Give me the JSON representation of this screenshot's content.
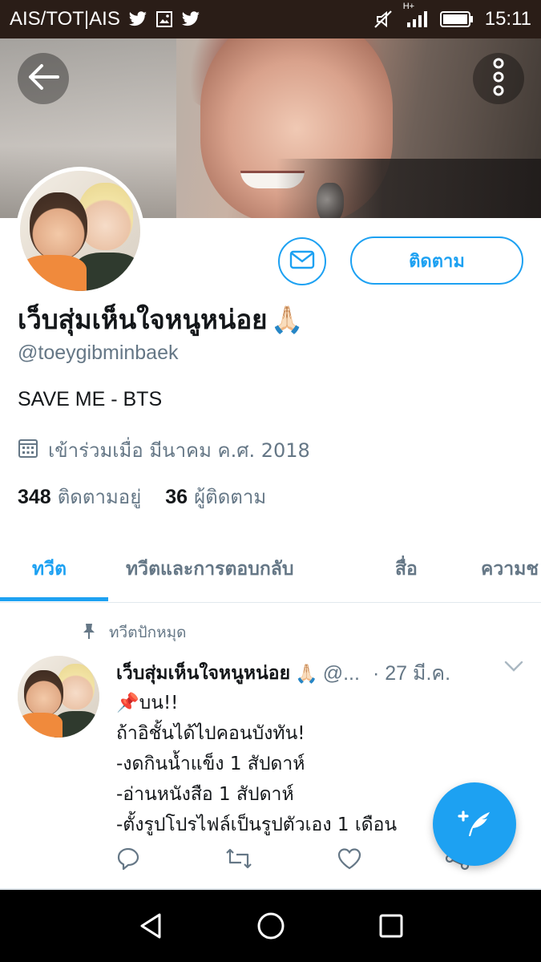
{
  "status_bar": {
    "carrier": "AIS/TOT|AIS",
    "network": "H+",
    "time": "15:11",
    "icons": [
      "twitter-icon",
      "image-notification-icon",
      "twitter-icon",
      "mute-icon",
      "signal-icon",
      "battery-icon"
    ]
  },
  "header": {
    "back_icon": "arrow-left-icon",
    "menu_icon": "more-vertical-icon"
  },
  "profile": {
    "display_name": "เว็บสุ่มเห็นใจหนูหน่อย",
    "name_emoji": "🙏🏻",
    "handle": "@toeygibminbaek",
    "bio": "SAVE ME - BTS",
    "joined": "เข้าร่วมเมื่อ มีนาคม ค.ศ. 2018",
    "following_count": "348",
    "following_label": "ติดตามอยู่",
    "followers_count": "36",
    "followers_label": "ผู้ติดตาม",
    "message_icon": "envelope-icon",
    "follow_label": "ติดตาม"
  },
  "tabs": [
    {
      "label": "ทวีต",
      "active": true
    },
    {
      "label": "ทวีตและการตอบกลับ",
      "active": false
    },
    {
      "label": "สื่อ",
      "active": false
    },
    {
      "label": "ความช",
      "active": false
    }
  ],
  "pinned_tweet": {
    "pinned_label": "ทวีตปักหมุด",
    "author_name": "เว็บสุ่มเห็นใจหนูหน่อย",
    "author_emoji": "🙏🏻",
    "author_handle": "@...",
    "date": "· 27 มี.ค.",
    "lines": [
      "📌บน!!",
      "ถ้าอิชั้นได้ไปคอนบังทัน!",
      "-งดกินน้ำแข็ง 1 สัปดาห์",
      "-อ่านหนังสือ 1 สัปดาห์",
      "-ตั้งรูปโปรไฟล์เป็นรูปตัวเอง 1 เดือน"
    ],
    "actions": [
      "reply-icon",
      "retweet-icon",
      "like-icon",
      "share-icon"
    ]
  },
  "fab": {
    "icon": "compose-tweet-icon"
  },
  "nav_bar": [
    "back-triangle-icon",
    "home-circle-icon",
    "recents-square-icon"
  ],
  "colors": {
    "accent": "#1da1f2",
    "secondary_text": "#657786",
    "primary_text": "#14171a",
    "status_bar": "#2a1d17"
  }
}
